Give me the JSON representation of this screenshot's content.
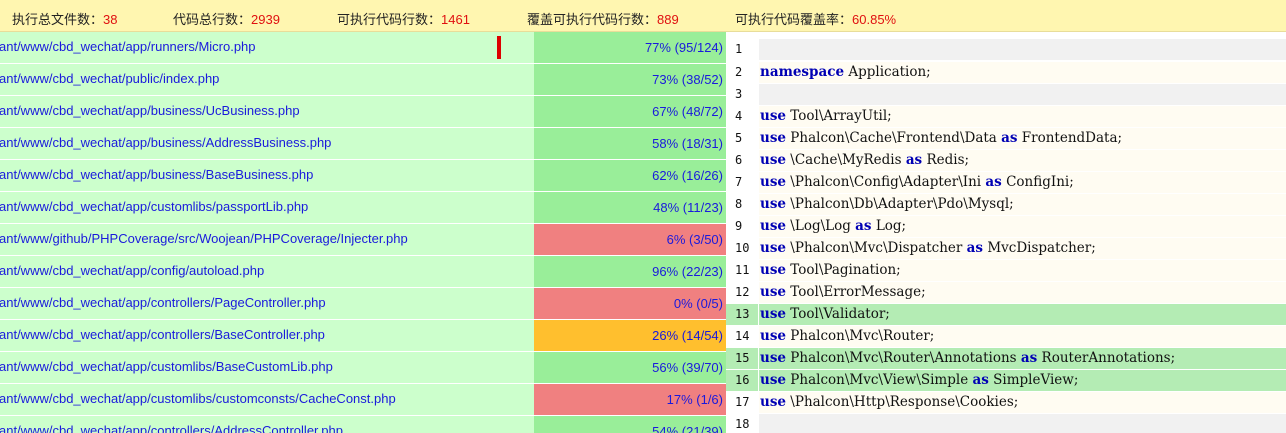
{
  "summary": {
    "files_label": "执行总文件数：",
    "files_value": "38",
    "lines_label": "代码总行数：",
    "lines_value": "2939",
    "exec_label": "可执行代码行数：",
    "exec_value": "1461",
    "covered_label": "覆盖可执行代码行数：",
    "covered_value": "889",
    "rate_label": "可执行代码覆盖率：",
    "rate_value": "60.85%"
  },
  "files": [
    {
      "path": "ant/www/cbd_wechat/app/runners/Micro.php",
      "coverage": "77% (95/124)",
      "level": "good"
    },
    {
      "path": "ant/www/cbd_wechat/public/index.php",
      "coverage": "73% (38/52)",
      "level": "good"
    },
    {
      "path": "ant/www/cbd_wechat/app/business/UcBusiness.php",
      "coverage": "67% (48/72)",
      "level": "good"
    },
    {
      "path": "ant/www/cbd_wechat/app/business/AddressBusiness.php",
      "coverage": "58% (18/31)",
      "level": "good"
    },
    {
      "path": "ant/www/cbd_wechat/app/business/BaseBusiness.php",
      "coverage": "62% (16/26)",
      "level": "good"
    },
    {
      "path": "ant/www/cbd_wechat/app/customlibs/passportLib.php",
      "coverage": "48% (11/23)",
      "level": "good"
    },
    {
      "path": "ant/www/github/PHPCoverage/src/Woojean/PHPCoverage/Injecter.php",
      "coverage": "6% (3/50)",
      "level": "bad"
    },
    {
      "path": "ant/www/cbd_wechat/app/config/autoload.php",
      "coverage": "96% (22/23)",
      "level": "good"
    },
    {
      "path": "ant/www/cbd_wechat/app/controllers/PageController.php",
      "coverage": "0% (0/5)",
      "level": "bad"
    },
    {
      "path": "ant/www/cbd_wechat/app/controllers/BaseController.php",
      "coverage": "26% (14/54)",
      "level": "mid"
    },
    {
      "path": "ant/www/cbd_wechat/app/customlibs/BaseCustomLib.php",
      "coverage": "56% (39/70)",
      "level": "good"
    },
    {
      "path": "ant/www/cbd_wechat/app/customlibs/customconsts/CacheConst.php",
      "coverage": "17% (1/6)",
      "level": "bad"
    },
    {
      "path": "ant/www/cbd_wechat/app/controllers/AddressController.php",
      "coverage": "54% (21/39)",
      "level": "good"
    }
  ],
  "source": [
    {
      "n": "1",
      "kind": "blank",
      "kw": "",
      "rest": ""
    },
    {
      "n": "2",
      "kind": "plain",
      "kw": "namespace",
      "rest": " Application;"
    },
    {
      "n": "3",
      "kind": "blank",
      "kw": "",
      "rest": ""
    },
    {
      "n": "4",
      "kind": "plain",
      "kw": "use",
      "rest": " Tool\\ArrayUtil;"
    },
    {
      "n": "5",
      "kind": "plain",
      "kw": "use",
      "rest": " Phalcon\\Cache\\Frontend\\Data ",
      "kw2": "as",
      "rest2": " FrontendData;"
    },
    {
      "n": "6",
      "kind": "plain",
      "kw": "use",
      "rest": " \\Cache\\MyRedis ",
      "kw2": "as",
      "rest2": " Redis;"
    },
    {
      "n": "7",
      "kind": "plain",
      "kw": "use",
      "rest": " \\Phalcon\\Config\\Adapter\\Ini ",
      "kw2": "as",
      "rest2": " ConfigIni;"
    },
    {
      "n": "8",
      "kind": "plain",
      "kw": "use",
      "rest": " \\Phalcon\\Db\\Adapter\\Pdo\\Mysql;"
    },
    {
      "n": "9",
      "kind": "plain",
      "kw": "use",
      "rest": " \\Log\\Log ",
      "kw2": "as",
      "rest2": " Log;"
    },
    {
      "n": "10",
      "kind": "plain",
      "kw": "use",
      "rest": " \\Phalcon\\Mvc\\Dispatcher ",
      "kw2": "as",
      "rest2": " MvcDispatcher;"
    },
    {
      "n": "11",
      "kind": "plain",
      "kw": "use",
      "rest": " Tool\\Pagination;"
    },
    {
      "n": "12",
      "kind": "plain",
      "kw": "use",
      "rest": " Tool\\ErrorMessage;"
    },
    {
      "n": "13",
      "kind": "cov",
      "kw": "use",
      "rest": " Tool\\Validator;"
    },
    {
      "n": "14",
      "kind": "plain",
      "kw": "use",
      "rest": " Phalcon\\Mvc\\Router;"
    },
    {
      "n": "15",
      "kind": "cov",
      "kw": "use",
      "rest": " Phalcon\\Mvc\\Router\\Annotations ",
      "kw2": "as",
      "rest2": " RouterAnnotations;"
    },
    {
      "n": "16",
      "kind": "cov",
      "kw": "use",
      "rest": " Phalcon\\Mvc\\View\\Simple ",
      "kw2": "as",
      "rest2": " SimpleView;"
    },
    {
      "n": "17",
      "kind": "plain",
      "kw": "use",
      "rest": " \\Phalcon\\Http\\Response\\Cookies;"
    },
    {
      "n": "18",
      "kind": "blank",
      "kw": "",
      "rest": ""
    }
  ],
  "colors": {
    "summary_bg": "#fff6b0",
    "value_red": "#e01010",
    "path_bg": "#ccffcc",
    "cov_good": "#99ee99",
    "cov_bad": "#f08080",
    "cov_mid": "#ffbf2e",
    "covered_line": "#b4ecb4",
    "keyword": "#0000b4",
    "link": "#1a1adc"
  }
}
